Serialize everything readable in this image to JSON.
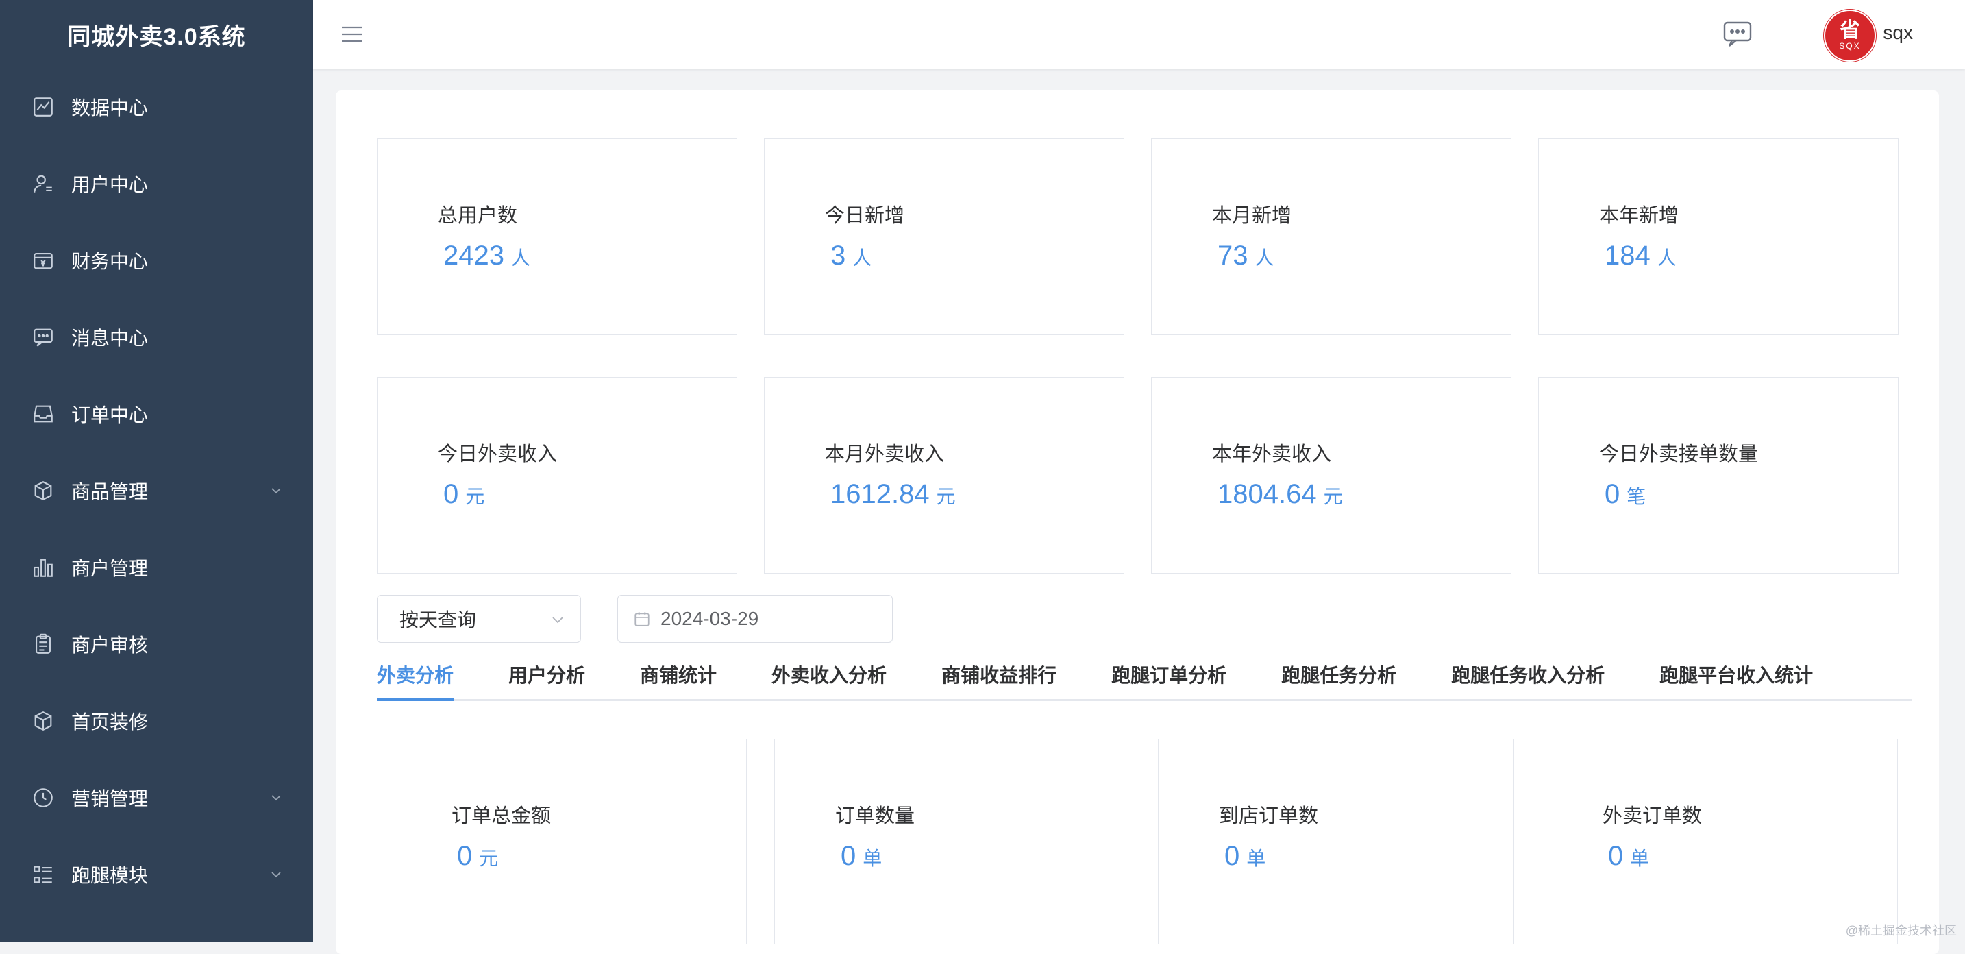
{
  "app": {
    "title": "同城外卖3.0系统"
  },
  "sidebar": {
    "items": [
      {
        "label": "数据中心",
        "icon": "chart-icon",
        "has_submenu": false
      },
      {
        "label": "用户中心",
        "icon": "user-icon",
        "has_submenu": false
      },
      {
        "label": "财务中心",
        "icon": "wallet-icon",
        "has_submenu": false
      },
      {
        "label": "消息中心",
        "icon": "message-icon",
        "has_submenu": false
      },
      {
        "label": "订单中心",
        "icon": "inbox-icon",
        "has_submenu": false
      },
      {
        "label": "商品管理",
        "icon": "box-icon",
        "has_submenu": true
      },
      {
        "label": "商户管理",
        "icon": "bars-icon",
        "has_submenu": false
      },
      {
        "label": "商户审核",
        "icon": "clipboard-icon",
        "has_submenu": false
      },
      {
        "label": "首页装修",
        "icon": "box-icon",
        "has_submenu": false
      },
      {
        "label": "营销管理",
        "icon": "clock-icon",
        "has_submenu": true
      },
      {
        "label": "跑腿模块",
        "icon": "list-icon",
        "has_submenu": true
      }
    ]
  },
  "header": {
    "user": {
      "name": "sqx",
      "avatar_text": "省",
      "avatar_sub": "SQX"
    }
  },
  "stats_users": [
    {
      "title": "总用户数",
      "value": "2423",
      "unit": "人"
    },
    {
      "title": "今日新增",
      "value": "3",
      "unit": "人"
    },
    {
      "title": "本月新增",
      "value": "73",
      "unit": "人"
    },
    {
      "title": "本年新增",
      "value": "184",
      "unit": "人"
    }
  ],
  "stats_income": [
    {
      "title": "今日外卖收入",
      "value": "0",
      "unit": "元"
    },
    {
      "title": "本月外卖收入",
      "value": "1612.84",
      "unit": "元"
    },
    {
      "title": "本年外卖收入",
      "value": "1804.64",
      "unit": "元"
    },
    {
      "title": "今日外卖接单数量",
      "value": "0",
      "unit": "笔"
    }
  ],
  "filters": {
    "query_mode": "按天查询",
    "date": "2024-03-29"
  },
  "tabs": [
    {
      "label": "外卖分析",
      "active": true
    },
    {
      "label": "用户分析",
      "active": false
    },
    {
      "label": "商铺统计",
      "active": false
    },
    {
      "label": "外卖收入分析",
      "active": false
    },
    {
      "label": "商铺收益排行",
      "active": false
    },
    {
      "label": "跑腿订单分析",
      "active": false
    },
    {
      "label": "跑腿任务分析",
      "active": false
    },
    {
      "label": "跑腿任务收入分析",
      "active": false
    },
    {
      "label": "跑腿平台收入统计",
      "active": false
    }
  ],
  "stats_orders": [
    {
      "title": "订单总金额",
      "value": "0",
      "unit": "元"
    },
    {
      "title": "订单数量",
      "value": "0",
      "unit": "单"
    },
    {
      "title": "到店订单数",
      "value": "0",
      "unit": "单"
    },
    {
      "title": "外卖订单数",
      "value": "0",
      "unit": "单"
    }
  ],
  "watermark": "@稀土掘金技术社区",
  "colors": {
    "sidebar_bg": "#304156",
    "accent": "#4a90e2",
    "avatar_bg": "#d6272b"
  }
}
